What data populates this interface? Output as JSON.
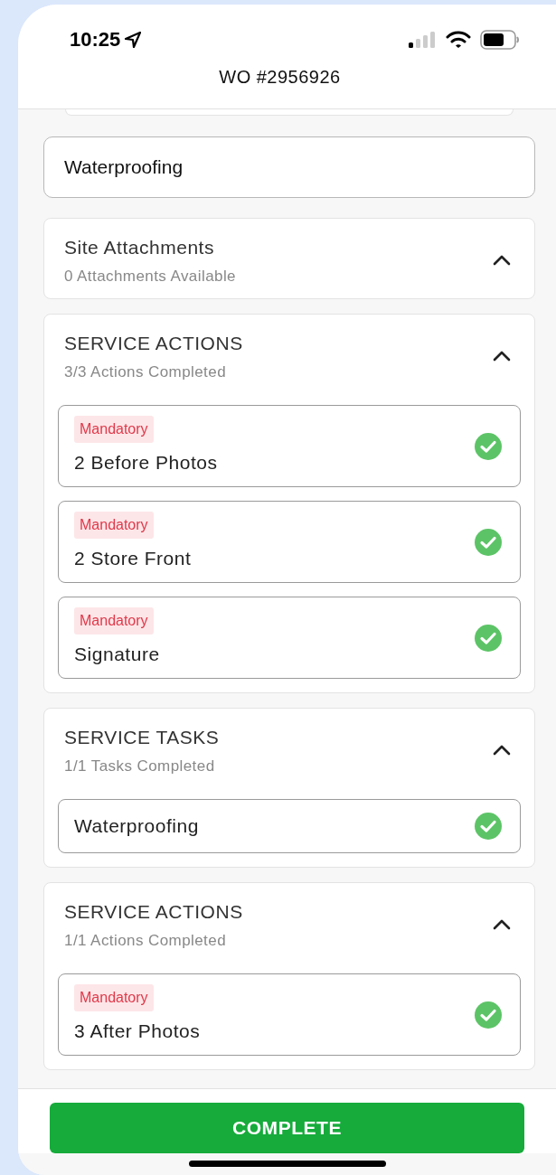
{
  "status_bar": {
    "time": "10:25"
  },
  "header": {
    "title": "WO #2956926"
  },
  "trade_field": {
    "value": "Waterproofing"
  },
  "sections": [
    {
      "title": "Site Attachments",
      "subtitle": "0 Attachments Available",
      "expanded": true
    },
    {
      "title": "SERVICE ACTIONS",
      "subtitle": "3/3 Actions Completed",
      "expanded": true,
      "items": [
        {
          "badge": "Mandatory",
          "label": "2 Before Photos",
          "done": true
        },
        {
          "badge": "Mandatory",
          "label": "2 Store Front",
          "done": true
        },
        {
          "badge": "Mandatory",
          "label": "Signature",
          "done": true
        }
      ]
    },
    {
      "title": "SERVICE TASKS",
      "subtitle": "1/1 Tasks Completed",
      "expanded": true,
      "items": [
        {
          "label": "Waterproofing",
          "done": true
        }
      ]
    },
    {
      "title": "SERVICE ACTIONS",
      "subtitle": "1/1 Actions Completed",
      "expanded": true,
      "items": [
        {
          "badge": "Mandatory",
          "label": "3 After Photos",
          "done": true
        }
      ]
    }
  ],
  "complete_button": {
    "label": "COMPLETE"
  }
}
